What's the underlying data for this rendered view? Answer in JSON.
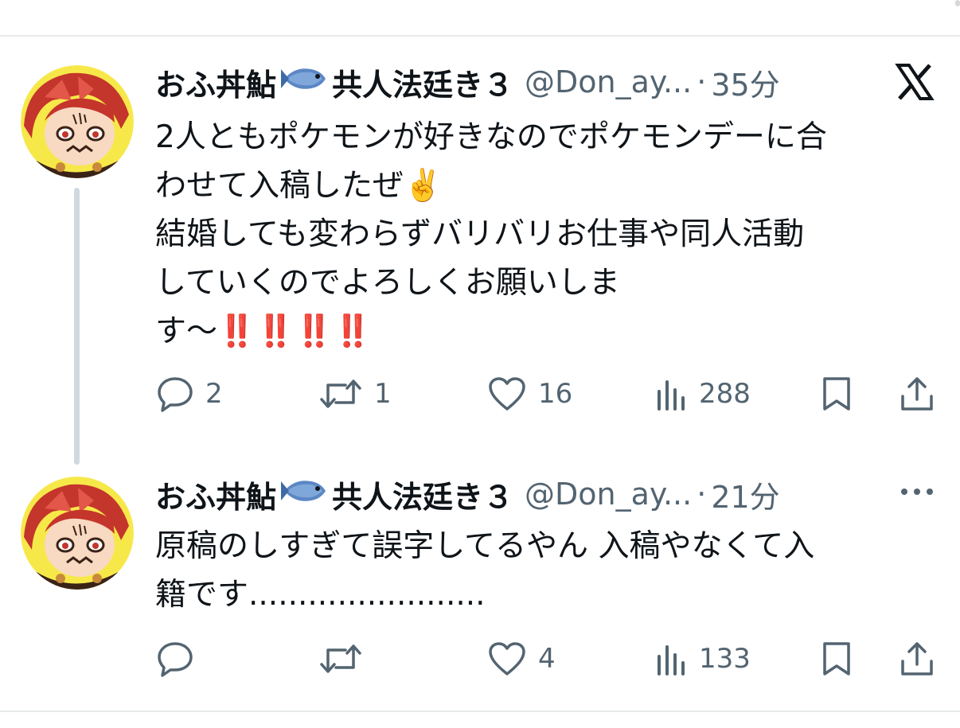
{
  "tweets": [
    {
      "display_name": "おふ丼鮎",
      "fish_emoji": "fish-icon",
      "display_name_2": "共人法廷き３",
      "handle": "@Don_ay...",
      "separator": "·",
      "time": "35分",
      "corner_icon": "x-logo-icon",
      "text_lines": [
        "2人ともポケモンが好きなのでポケモンデーに合",
        "わせて入稿したぜ✌️",
        "結婚しても変わらずバリバリお仕事や同人活動",
        "していくのでよろしくお願いしま",
        "す〜‼️‼️‼️‼️"
      ],
      "actions": {
        "reply": "2",
        "retweet": "1",
        "like": "16",
        "views": "288"
      }
    },
    {
      "display_name": "おふ丼鮎",
      "fish_emoji": "fish-icon",
      "display_name_2": "共人法廷き３",
      "handle": "@Don_ay...",
      "separator": "·",
      "time": "21分",
      "corner_icon": "more-dots-icon",
      "text_lines": [
        "原稿のしすぎて誤字してるやん 入稿やなくて入",
        "籍です........................"
      ],
      "actions": {
        "reply": "",
        "retweet": "",
        "like": "4",
        "views": "133"
      }
    }
  ],
  "colors": {
    "text": "#0f1419",
    "secondary": "#536471",
    "divider": "#e7e9ea",
    "thread_line": "#cfd9de",
    "avatar_bg": "#f7e84a",
    "hair": "#c4352b"
  }
}
